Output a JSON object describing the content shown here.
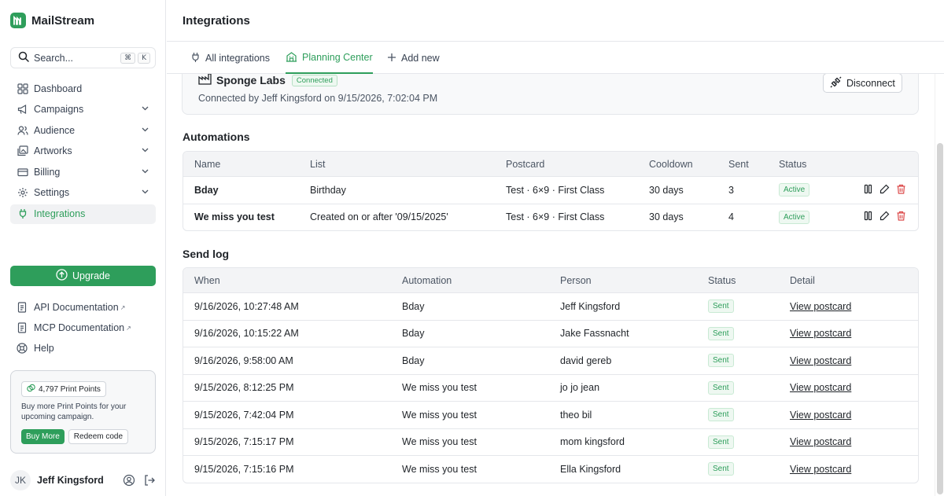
{
  "brand": {
    "name": "MailStream"
  },
  "search": {
    "label": "Search...",
    "kbd_cmd": "⌘",
    "kbd_key": "K"
  },
  "sidebar": {
    "items": [
      {
        "label": "Dashboard",
        "icon": "dashboard-icon",
        "chevron": false
      },
      {
        "label": "Campaigns",
        "icon": "megaphone-icon",
        "chevron": true
      },
      {
        "label": "Audience",
        "icon": "users-icon",
        "chevron": true
      },
      {
        "label": "Artworks",
        "icon": "image-icon",
        "chevron": true
      },
      {
        "label": "Billing",
        "icon": "credit-card-icon",
        "chevron": true
      },
      {
        "label": "Settings",
        "icon": "gear-icon",
        "chevron": true
      },
      {
        "label": "Integrations",
        "icon": "plug-icon",
        "chevron": false,
        "active": true
      }
    ],
    "upgrade_label": "Upgrade",
    "links": [
      {
        "label": "API Documentation",
        "external": "↗"
      },
      {
        "label": "MCP Documentation",
        "external": "↗"
      },
      {
        "label": "Help",
        "external": ""
      }
    ],
    "points": {
      "pill": "4,797 Print Points",
      "text": "Buy more Print Points for your upcoming campaign.",
      "buy_label": "Buy More",
      "redeem_label": "Redeem code"
    },
    "user": {
      "initials": "JK",
      "name": "Jeff Kingsford"
    }
  },
  "header": {
    "title": "Integrations"
  },
  "tabs": [
    {
      "label": "All integrations",
      "icon": "plug-icon"
    },
    {
      "label": "Planning Center",
      "icon": "building-icon",
      "active": true
    },
    {
      "label": "Add new",
      "icon": "plus-icon"
    }
  ],
  "connection": {
    "name": "Sponge Labs",
    "badge": "Connected",
    "subtitle": "Connected by Jeff Kingsford on 9/15/2026, 7:02:04 PM",
    "disconnect_label": "Disconnect"
  },
  "automations": {
    "title": "Automations",
    "columns": [
      "Name",
      "List",
      "Postcard",
      "Cooldown",
      "Sent",
      "Status"
    ],
    "rows": [
      {
        "name": "Bday",
        "list": "Birthday",
        "postcard": "Test · 6×9 · First Class",
        "cooldown": "30 days",
        "sent": "3",
        "status": "Active"
      },
      {
        "name": "We miss you test",
        "list": "Created on or after '09/15/2025'",
        "postcard": "Test · 6×9 · First Class",
        "cooldown": "30 days",
        "sent": "4",
        "status": "Active"
      }
    ]
  },
  "send_log": {
    "title": "Send log",
    "columns": [
      "When",
      "Automation",
      "Person",
      "Status",
      "Detail"
    ],
    "rows": [
      {
        "when": "9/16/2026, 10:27:48 AM",
        "automation": "Bday",
        "person": "Jeff Kingsford",
        "status": "Sent",
        "detail": "View postcard"
      },
      {
        "when": "9/16/2026, 10:15:22 AM",
        "automation": "Bday",
        "person": "Jake Fassnacht",
        "status": "Sent",
        "detail": "View postcard"
      },
      {
        "when": "9/16/2026, 9:58:00 AM",
        "automation": "Bday",
        "person": "david gereb",
        "status": "Sent",
        "detail": "View postcard"
      },
      {
        "when": "9/15/2026, 8:12:25 PM",
        "automation": "We miss you test",
        "person": "jo jo jean",
        "status": "Sent",
        "detail": "View postcard"
      },
      {
        "when": "9/15/2026, 7:42:04 PM",
        "automation": "We miss you test",
        "person": "theo bil",
        "status": "Sent",
        "detail": "View postcard"
      },
      {
        "when": "9/15/2026, 7:15:17 PM",
        "automation": "We miss you test",
        "person": "mom kingsford",
        "status": "Sent",
        "detail": "View postcard"
      },
      {
        "when": "9/15/2026, 7:15:16 PM",
        "automation": "We miss you test",
        "person": "Ella Kingsford",
        "status": "Sent",
        "detail": "View postcard"
      }
    ]
  },
  "colors": {
    "accent": "#2e9e5b",
    "border": "#e5e7eb",
    "danger": "#dc4a4a"
  }
}
